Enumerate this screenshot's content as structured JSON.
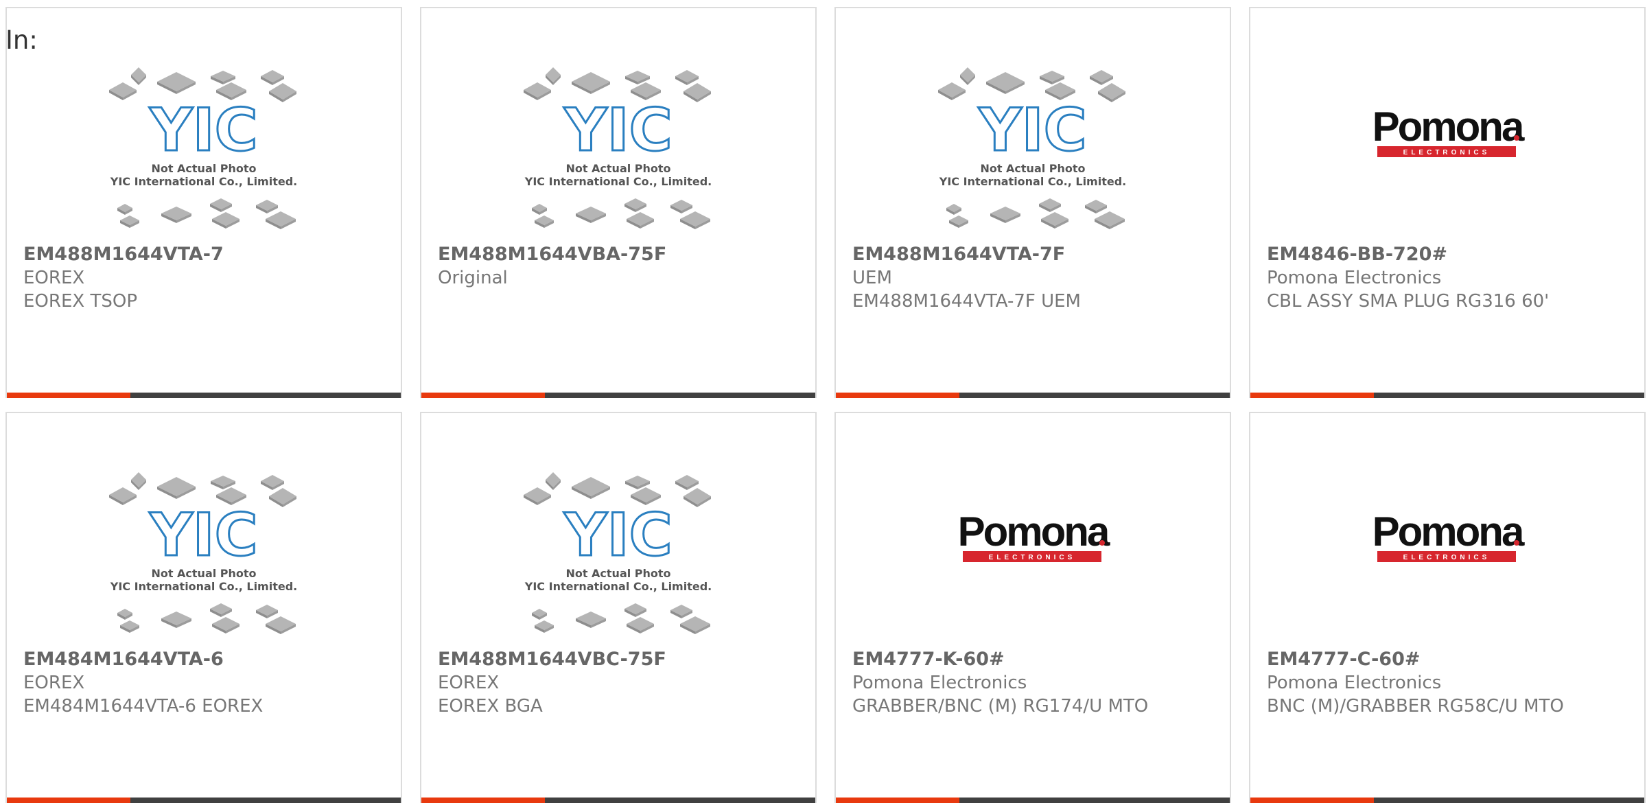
{
  "header": {
    "in_label": "In:"
  },
  "products": [
    {
      "part_number": "EM488M1644VTA-7",
      "line1": "EOREX",
      "line2": "EOREX TSOP",
      "image": "yic-placeholder"
    },
    {
      "part_number": "EM488M1644VBA-75F",
      "line1": "Original",
      "line2": "",
      "image": "yic-placeholder"
    },
    {
      "part_number": "EM488M1644VTA-7F",
      "line1": "UEM",
      "line2": "EM488M1644VTA-7F UEM",
      "image": "yic-placeholder"
    },
    {
      "part_number": "EM4846-BB-720#",
      "line1": "Pomona Electronics",
      "line2": "CBL ASSY SMA PLUG RG316 60'",
      "image": "pomona-logo"
    },
    {
      "part_number": "EM484M1644VTA-6",
      "line1": "EOREX",
      "line2": "EM484M1644VTA-6 EOREX",
      "image": "yic-placeholder"
    },
    {
      "part_number": "EM488M1644VBC-75F",
      "line1": "EOREX",
      "line2": "EOREX BGA",
      "image": "yic-placeholder"
    },
    {
      "part_number": "EM4777-K-60#",
      "line1": "Pomona Electronics",
      "line2": "GRABBER/BNC (M) RG174/U MTO",
      "image": "pomona-logo"
    },
    {
      "part_number": "EM4777-C-60#",
      "line1": "Pomona Electronics",
      "line2": "BNC (M)/GRABBER RG58C/U MTO",
      "image": "pomona-logo"
    }
  ],
  "placeholder": {
    "caption1": "Not Actual Photo",
    "caption2": "YIC International Co., Limited.",
    "logo_text": "YIC"
  },
  "pomona": {
    "name": "Pomona",
    "sub": "ELECTRONICS"
  },
  "colors": {
    "accent": "#e8390e",
    "bar": "#404040",
    "yic_blue": "#2a7fc0",
    "pomona_red": "#d7262e"
  }
}
